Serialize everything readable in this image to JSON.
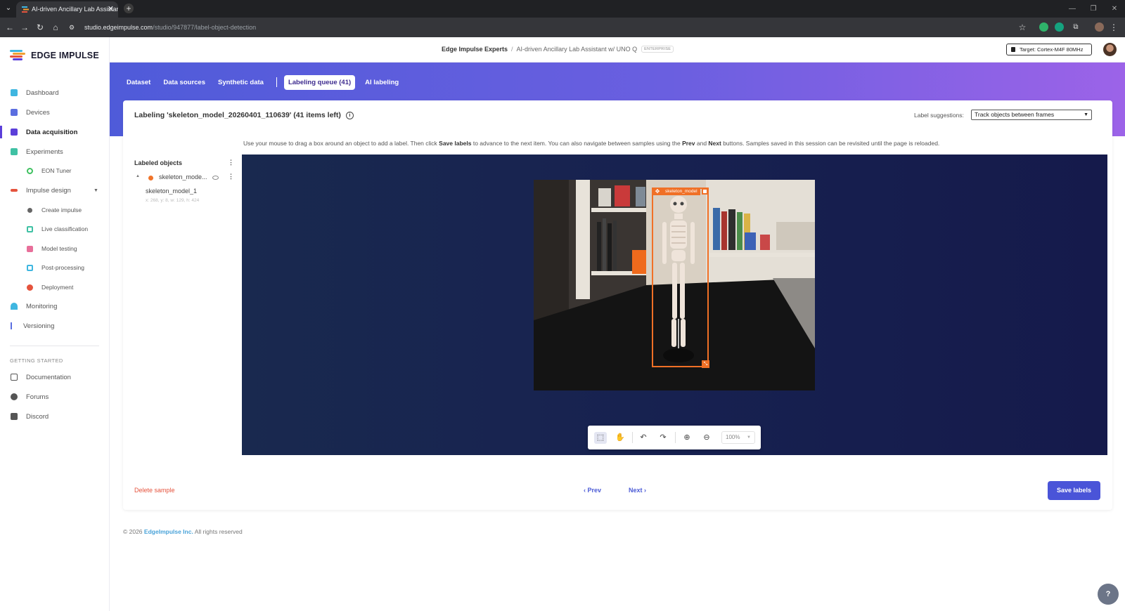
{
  "browser": {
    "tab_title": "AI-driven Ancillary Lab Assistan",
    "url_host": "studio.edgeimpulse.com",
    "url_path": "/studio/947877/label-object-detection"
  },
  "sidebar": {
    "logo_text": "EDGE IMPULSE",
    "items": [
      {
        "label": "Dashboard",
        "icon": "monitor-icon",
        "color": "#3fb6e0"
      },
      {
        "label": "Devices",
        "icon": "device-icon",
        "color": "#5b6ee0"
      },
      {
        "label": "Data acquisition",
        "icon": "database-icon",
        "color": "#5b3fd9"
      },
      {
        "label": "Experiments",
        "icon": "grid-icon",
        "color": "#3fc1a4"
      },
      {
        "label": "EON Tuner",
        "icon": "tuner-icon",
        "color": "#3fc160"
      },
      {
        "label": "Impulse design",
        "icon": "pulse-icon",
        "color": "#e5533d"
      },
      {
        "label": "Create impulse",
        "icon": "dot-icon",
        "color": "#666666"
      },
      {
        "label": "Live classification",
        "icon": "live-icon",
        "color": "#3fc1a4"
      },
      {
        "label": "Model testing",
        "icon": "test-icon",
        "color": "#e86f9a"
      },
      {
        "label": "Post-processing",
        "icon": "post-icon",
        "color": "#3fb6e0"
      },
      {
        "label": "Deployment",
        "icon": "deploy-icon",
        "color": "#e5533d"
      },
      {
        "label": "Monitoring",
        "icon": "monitoring-icon",
        "color": "#3fb6e0"
      },
      {
        "label": "Versioning",
        "icon": "branch-icon",
        "color": "#5b6ee0"
      }
    ],
    "section_label": "GETTING STARTED",
    "getting_started": [
      {
        "label": "Documentation",
        "icon": "docs-icon"
      },
      {
        "label": "Forums",
        "icon": "forum-icon"
      },
      {
        "label": "Discord",
        "icon": "discord-icon"
      }
    ]
  },
  "header": {
    "org": "Edge Impulse Experts",
    "project": "AI-driven Ancillary Lab Assistant w/ UNO Q",
    "badge": "ENTERPRISE",
    "target": "Target: Cortex-M4F 80MHz"
  },
  "subnav": {
    "tabs": [
      "Dataset",
      "Data sources",
      "Synthetic data"
    ],
    "active_tab": "Labeling queue (41)",
    "last_tab": "AI labeling"
  },
  "panel": {
    "title": "Labeling 'skeleton_model_20260401_110639' (41 items left)",
    "suggestions_label": "Label suggestions:",
    "suggestions_value": "Track objects between frames",
    "instructions": {
      "p1": "Use your mouse to drag a box around an object to add a label. Then click ",
      "b1": "Save labels",
      "p2": " to advance to the next item. You can also navigate between samples using the ",
      "b2": "Prev",
      "p3": " and ",
      "b3": "Next",
      "p4": " buttons. Samples saved in this session can be revisited until the page is reloaded."
    },
    "labeled_objects_title": "Labeled objects",
    "object_label": "skeleton_mode...",
    "object_instance": "skeleton_model_1",
    "object_coords": "x: 268, y: 8, w: 129, h: 424",
    "bbox_label": "skeleton_model",
    "zoom": "100%",
    "delete_label": "Delete sample",
    "prev_label": "Prev",
    "next_label": "Next",
    "save_label": "Save labels"
  },
  "footer": {
    "year": "© 2026",
    "brand": "EdgeImpulse Inc.",
    "rights": "All rights reserved"
  },
  "colors": {
    "accent": "#4a54d8",
    "bbox": "#f07026",
    "delete": "#e5533d"
  }
}
